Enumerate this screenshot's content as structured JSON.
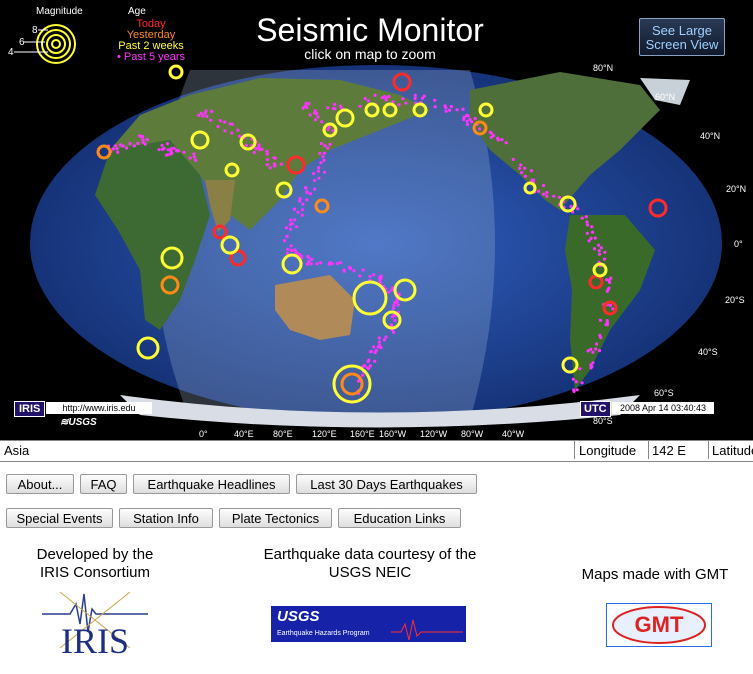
{
  "header": {
    "title": "Seismic Monitor",
    "subtitle": "click on map to zoom",
    "large_view_label_1": "See Large",
    "large_view_label_2": "Screen View"
  },
  "legend": {
    "magnitude_title": "Magnitude",
    "age_title": "Age",
    "magnitudes": [
      "8",
      "6",
      "4"
    ],
    "ages": [
      {
        "label": "Today",
        "color": "#ff2a2a"
      },
      {
        "label": "Yesterday",
        "color": "#ff8a1a"
      },
      {
        "label": "Past 2 weeks",
        "color": "#ffff33"
      },
      {
        "label": "Past 5 years",
        "color": "#ff33ff"
      }
    ]
  },
  "map": {
    "lat_labels": [
      "80°N",
      "60°N",
      "40°N",
      "20°N",
      "0°",
      "20°S",
      "40°S",
      "60°S",
      "80°S"
    ],
    "lon_labels": [
      "0°",
      "40°E",
      "80°E",
      "120°E",
      "160°E",
      "160°W",
      "120°W",
      "80°W",
      "40°W"
    ],
    "iris_badge": "IRIS",
    "iris_url": "http://www.iris.edu",
    "usgs_label": "USGS",
    "utc_badge": "UTC",
    "utc_time": "2008 Apr 14 03:40:43"
  },
  "status": {
    "region": "Asia",
    "longitude_label": "Longitude",
    "longitude_value": "142 E",
    "latitude_label": "Latitude"
  },
  "buttons_row1": [
    "About...",
    "FAQ",
    "Earthquake Headlines",
    "Last 30 Days Earthquakes"
  ],
  "buttons_row2": [
    "Special Events",
    "Station Info",
    "Plate Tectonics",
    "Education Links"
  ],
  "credits": {
    "iris_line1": "Developed by the",
    "iris_line2": "IRIS Consortium",
    "iris_logo_text": "IRIS",
    "usgs_line1": "Earthquake data courtesy of the",
    "usgs_line2": "USGS NEIC",
    "usgs_logo_text": "USGS",
    "usgs_logo_sub": "Earthquake Hazards Program",
    "gmt_line": "Maps made with GMT",
    "gmt_logo_text": "GMT"
  }
}
